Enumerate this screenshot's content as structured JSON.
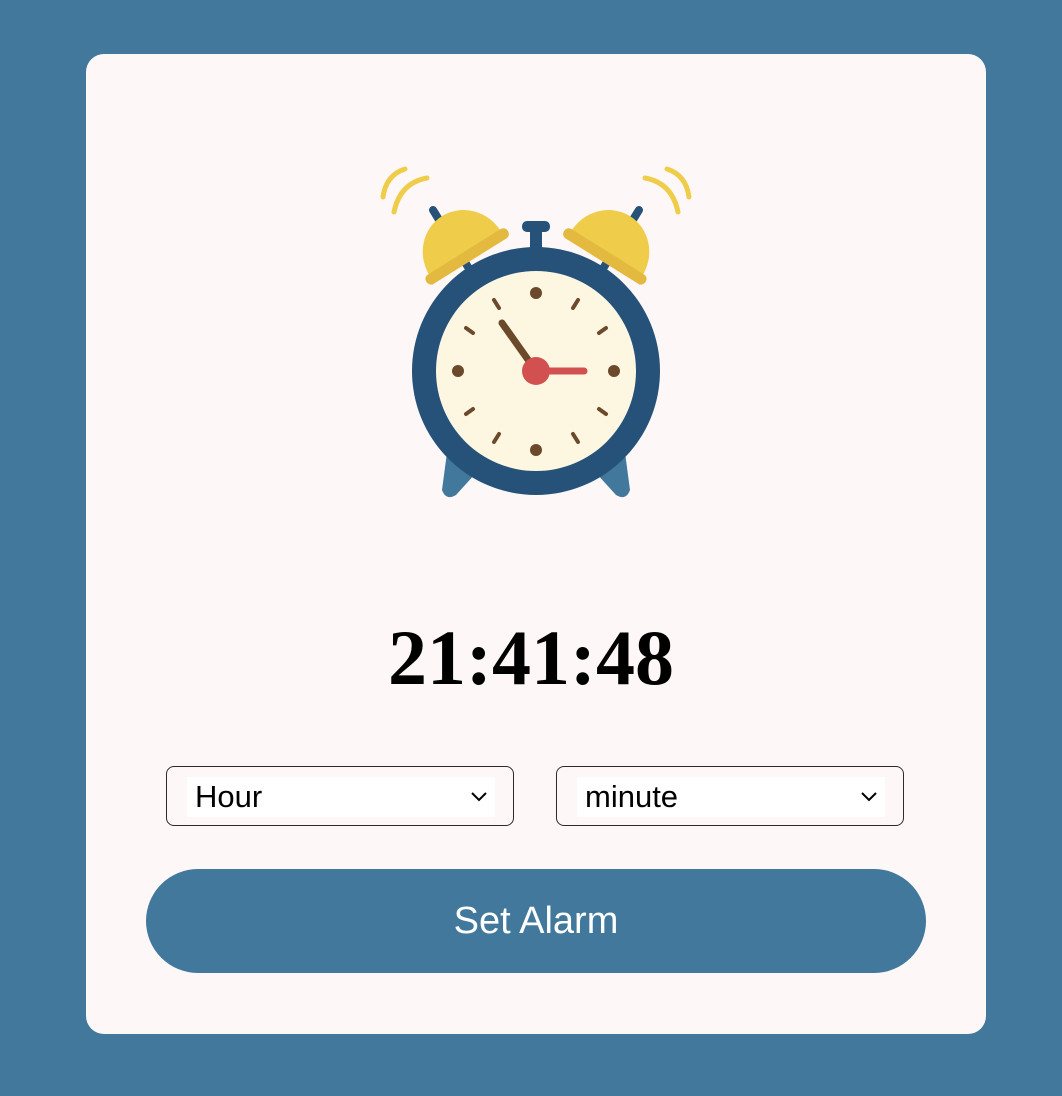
{
  "colors": {
    "page_background": "#41789c",
    "card_background": "#fdf8f7",
    "button_background": "#41789c",
    "button_text": "#ffffff",
    "clock_rim": "#265178",
    "clock_face": "#fdf7e1",
    "bells": "#efcc4a",
    "hour_hand": "#6b4a2b",
    "minute_hand": "#d2504f"
  },
  "illustration": {
    "icon": "alarm-clock-icon"
  },
  "clock": {
    "time": "21:41:48"
  },
  "hour_select": {
    "selected": "Hour"
  },
  "minute_select": {
    "selected": "minute"
  },
  "set_alarm_button": {
    "label": "Set Alarm"
  }
}
